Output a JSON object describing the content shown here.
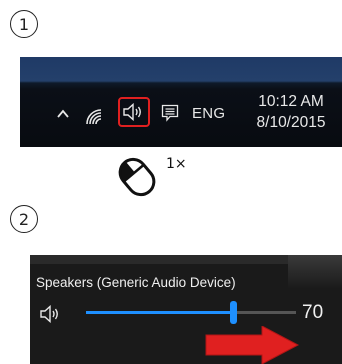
{
  "steps": {
    "step1": "1",
    "step2": "2"
  },
  "taskbar": {
    "language": "ENG",
    "time": "10:12 AM",
    "date": "8/10/2015",
    "icons": [
      "chevron-up-icon",
      "wifi-icon",
      "volume-icon",
      "action-center-icon"
    ]
  },
  "instruction": {
    "click_count": "1×",
    "icon": "mouse-click-icon"
  },
  "volume_popup": {
    "device_name": "Speakers (Generic Audio Device)",
    "value_label": "70",
    "level": 0.7,
    "accent_color": "#1e90ff",
    "arrow_color": "#e02020"
  }
}
